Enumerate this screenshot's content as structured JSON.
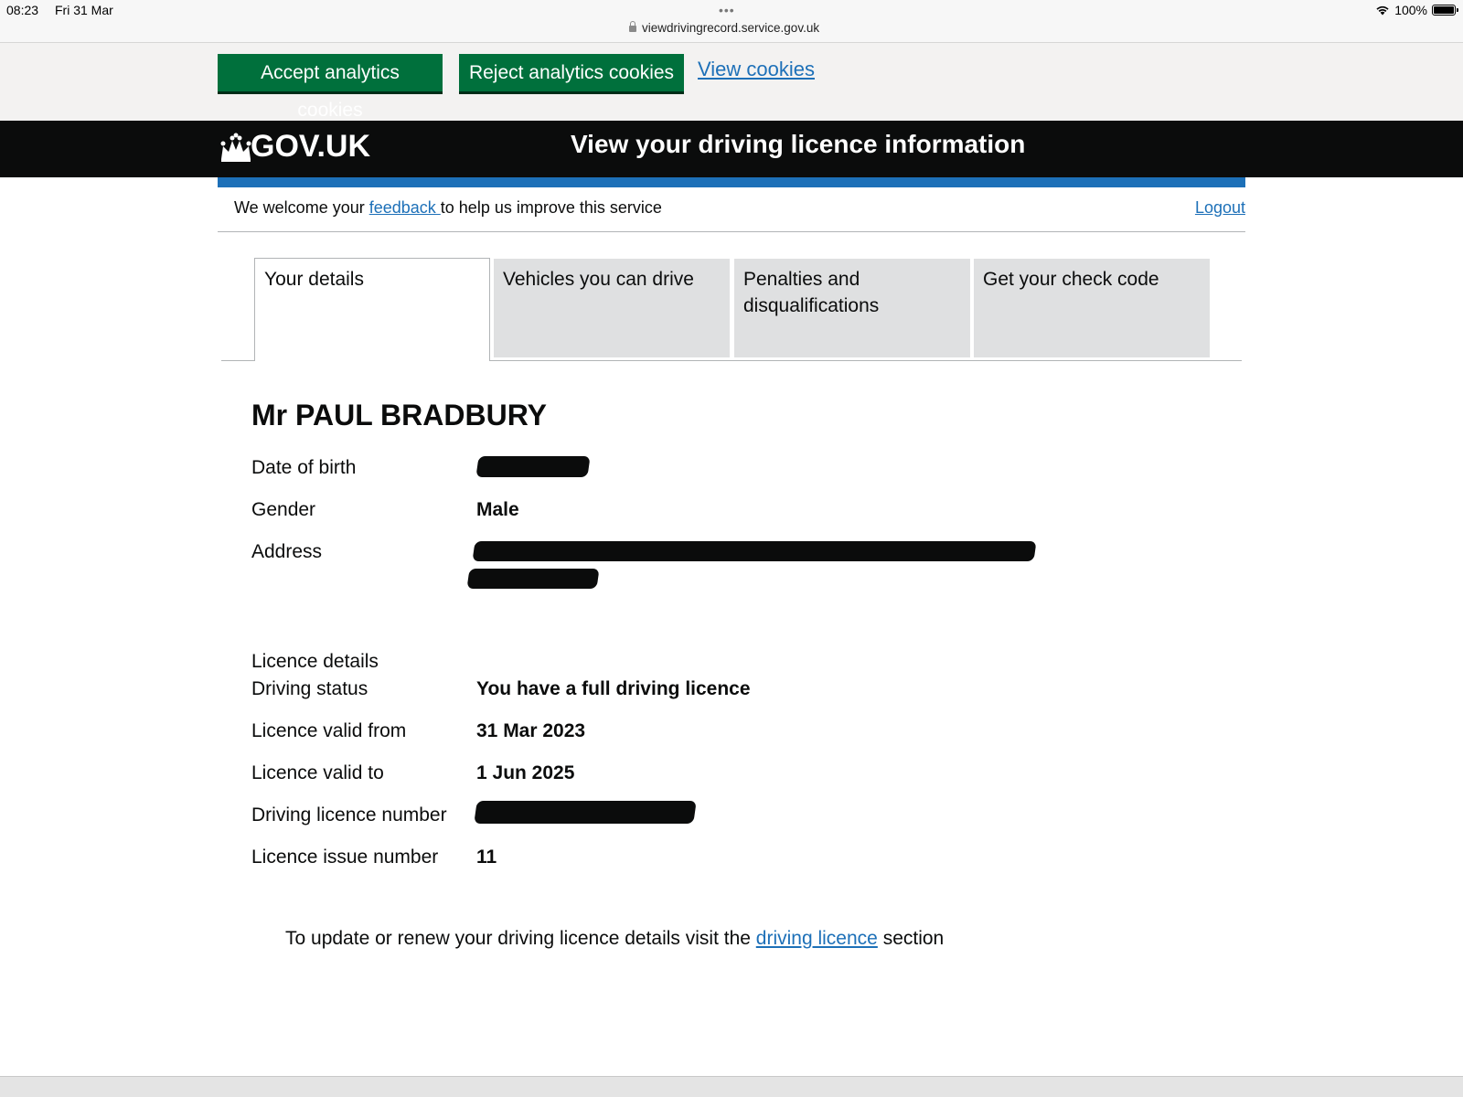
{
  "status_bar": {
    "time": "08:23",
    "date": "Fri 31 Mar",
    "url": "viewdrivingrecord.service.gov.uk",
    "battery": "100%"
  },
  "cookie_banner": {
    "accept_label": "Accept analytics cookies",
    "reject_label": "Reject analytics cookies",
    "view_label": "View cookies"
  },
  "header": {
    "logo_text": "GOV.UK",
    "service_name": "View your driving licence information"
  },
  "feedback": {
    "prefix": "We welcome your ",
    "link": "feedback ",
    "suffix": "to help us improve this service",
    "logout": "Logout"
  },
  "tabs": [
    {
      "label": "Your details",
      "active": true
    },
    {
      "label": "Vehicles you can drive",
      "active": false
    },
    {
      "label": "Penalties and disqualifications",
      "active": false
    },
    {
      "label": "Get your check code",
      "active": false
    }
  ],
  "details": {
    "name": "Mr PAUL BRADBURY",
    "dob_label": "Date of birth",
    "gender_label": "Gender",
    "gender_value": "Male",
    "address_label": "Address",
    "licence_details_label": "Licence details",
    "driving_status_label": "Driving status",
    "driving_status_value": "You have a full driving licence",
    "valid_from_label": "Licence valid from",
    "valid_from_value": "31 Mar 2023",
    "valid_to_label": "Licence valid to",
    "valid_to_value": "1 Jun 2025",
    "licence_number_label": "Driving licence number",
    "issue_number_label": "Licence issue number",
    "issue_number_value": "11"
  },
  "footer": {
    "prefix": "To update or renew your driving licence details visit the ",
    "link": "driving licence",
    "suffix": " section"
  },
  "colors": {
    "link": "#1d70b8",
    "button_green": "#00703c",
    "header_black": "#0b0c0c"
  }
}
